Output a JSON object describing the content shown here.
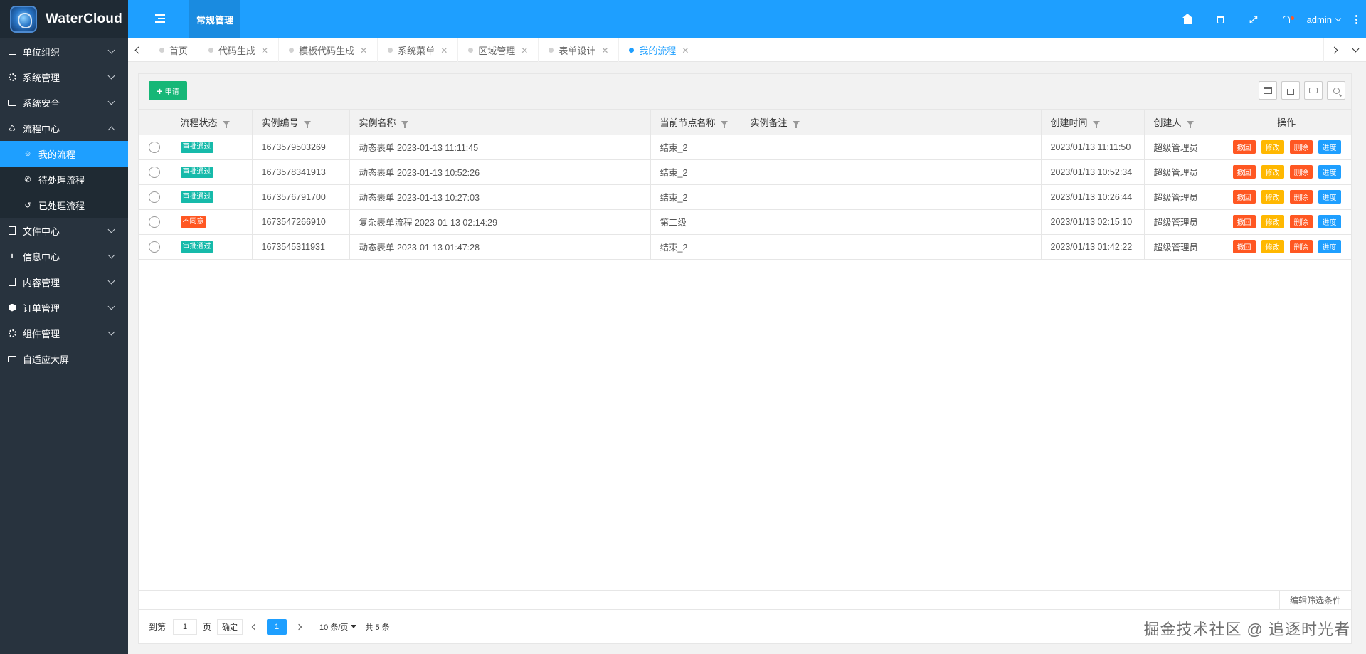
{
  "app": {
    "name": "WaterCloud"
  },
  "header": {
    "section_tab": "常规管理",
    "user": "admin",
    "accent": "#1e9fff"
  },
  "sidebar": {
    "items": [
      {
        "label": "单位组织",
        "icon": "sitemap-icon"
      },
      {
        "label": "系统管理",
        "icon": "cogs-icon"
      },
      {
        "label": "系统安全",
        "icon": "desktop-icon"
      },
      {
        "label": "流程中心",
        "icon": "flow-icon",
        "expanded": true
      },
      {
        "label": "文件中心",
        "icon": "file-icon"
      },
      {
        "label": "信息中心",
        "icon": "info-icon"
      },
      {
        "label": "内容管理",
        "icon": "book-icon"
      },
      {
        "label": "订单管理",
        "icon": "cube-icon"
      },
      {
        "label": "组件管理",
        "icon": "gear-icon"
      },
      {
        "label": "自适应大屏",
        "icon": "monitor-icon"
      }
    ],
    "sub_items": [
      {
        "label": "我的流程",
        "active": true
      },
      {
        "label": "待处理流程"
      },
      {
        "label": "已处理流程"
      }
    ]
  },
  "tabs": [
    {
      "label": "首页"
    },
    {
      "label": "代码生成",
      "closable": true
    },
    {
      "label": "模板代码生成",
      "closable": true
    },
    {
      "label": "系统菜单",
      "closable": true
    },
    {
      "label": "区域管理",
      "closable": true
    },
    {
      "label": "表单设计",
      "closable": true
    },
    {
      "label": "我的流程",
      "closable": true,
      "active": true
    }
  ],
  "toolbar": {
    "add_label": "申请"
  },
  "table": {
    "columns": [
      "流程状态",
      "实例编号",
      "实例名称",
      "当前节点名称",
      "实例备注",
      "创建时间",
      "创建人",
      "操作"
    ],
    "rows": [
      {
        "status": "审批通过",
        "status_type": "ok",
        "code": "1673579503269",
        "name": "动态表单 2023-01-13 11:11:45",
        "node": "结束_2",
        "remark": "",
        "time": "2023/01/13 11:11:50",
        "creator": "超级管理员"
      },
      {
        "status": "审批通过",
        "status_type": "ok",
        "code": "1673578341913",
        "name": "动态表单 2023-01-13 10:52:26",
        "node": "结束_2",
        "remark": "",
        "time": "2023/01/13 10:52:34",
        "creator": "超级管理员"
      },
      {
        "status": "审批通过",
        "status_type": "ok",
        "code": "1673576791700",
        "name": "动态表单 2023-01-13 10:27:03",
        "node": "结束_2",
        "remark": "",
        "time": "2023/01/13 10:26:44",
        "creator": "超级管理员"
      },
      {
        "status": "不同意",
        "status_type": "no",
        "code": "1673547266910",
        "name": "复杂表单流程 2023-01-13 02:14:29",
        "node": "第二级",
        "remark": "",
        "time": "2023/01/13 02:15:10",
        "creator": "超级管理员"
      },
      {
        "status": "审批通过",
        "status_type": "ok",
        "code": "1673545311931",
        "name": "动态表单 2023-01-13 01:47:28",
        "node": "结束_2",
        "remark": "",
        "time": "2023/01/13 01:42:22",
        "creator": "超级管理员"
      }
    ],
    "row_actions": [
      {
        "label": "撤回",
        "color": "#ff5722"
      },
      {
        "label": "修改",
        "color": "#ffb800"
      },
      {
        "label": "删除",
        "color": "#ff5722"
      },
      {
        "label": "进度",
        "color": "#1e9fff"
      }
    ]
  },
  "filter_edit": "编辑筛选条件",
  "pager": {
    "goto_label": "到第",
    "goto_value": "1",
    "page_unit": "页",
    "confirm": "确定",
    "current_page": "1",
    "limit": "10 条/页",
    "total": "共 5 条"
  },
  "watermark": "掘金技术社区 @ 追逐时光者"
}
